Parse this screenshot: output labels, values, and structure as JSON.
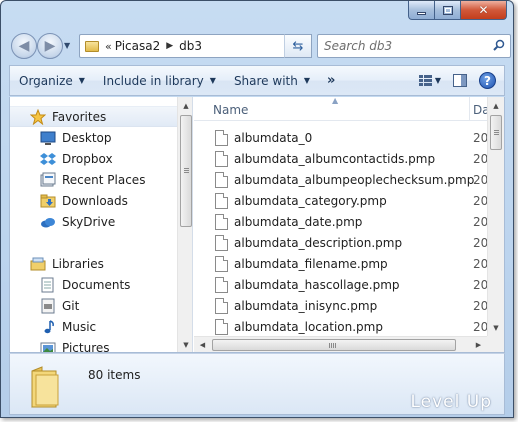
{
  "window": {
    "caption": {
      "minimize": "minimize",
      "maximize": "maximize",
      "close": "close"
    }
  },
  "nav": {
    "address": {
      "chevron": "«",
      "segments": [
        "Picasa2",
        "db3"
      ]
    },
    "search": {
      "placeholder": "Search db3"
    }
  },
  "toolbar": {
    "commands": [
      {
        "label": "Organize",
        "has_dropdown": true
      },
      {
        "label": "Include in library",
        "has_dropdown": true
      },
      {
        "label": "Share with",
        "has_dropdown": true
      }
    ],
    "overflow": "»",
    "help": "?"
  },
  "navpane": {
    "favorites_header": "Favorites",
    "favorites": [
      "Desktop",
      "Dropbox",
      "Recent Places",
      "Downloads",
      "SkyDrive"
    ],
    "libraries_header": "Libraries",
    "libraries": [
      "Documents",
      "Git",
      "Music",
      "Pictures"
    ]
  },
  "filelist": {
    "columns": {
      "name": "Name",
      "date": "Dat"
    },
    "files": [
      {
        "name": "albumdata_0",
        "date": "201"
      },
      {
        "name": "albumdata_albumcontactids.pmp",
        "date": "201"
      },
      {
        "name": "albumdata_albumpeoplechecksum.pmp",
        "date": "201"
      },
      {
        "name": "albumdata_category.pmp",
        "date": "201"
      },
      {
        "name": "albumdata_date.pmp",
        "date": "201"
      },
      {
        "name": "albumdata_description.pmp",
        "date": "201"
      },
      {
        "name": "albumdata_filename.pmp",
        "date": "201"
      },
      {
        "name": "albumdata_hascollage.pmp",
        "date": "201"
      },
      {
        "name": "albumdata_inisync.pmp",
        "date": "201"
      },
      {
        "name": "albumdata_location.pmp",
        "date": "201"
      }
    ]
  },
  "details": {
    "item_count": "80 items",
    "watermark": "Level Up"
  },
  "colors": {
    "frame": "#bcd4ee",
    "accent": "#1e395b",
    "folder": "#e2bb4c"
  }
}
